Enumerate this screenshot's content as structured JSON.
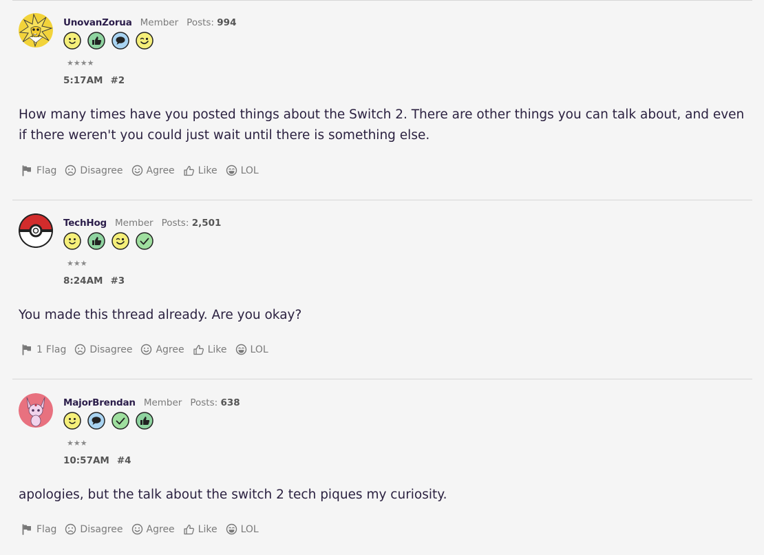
{
  "posts": [
    {
      "username": "UnovanZorua",
      "role": "Member",
      "posts_label": "Posts:",
      "posts_count": "994",
      "stars": "★★★★",
      "time": "5:17AM",
      "number": "#2",
      "body": "How many times have you posted things about the Switch 2. There are other things you can talk about, and even if there weren't you could just wait until there is something else.",
      "badges": [
        "smiley-badge-icon",
        "thumbs-up-badge-icon",
        "speech-bubble-badge-icon",
        "wink-badge-icon"
      ],
      "actions": {
        "flag": "Flag",
        "disagree": "Disagree",
        "agree": "Agree",
        "like": "Like",
        "lol": "LOL"
      }
    },
    {
      "username": "TechHog",
      "role": "Member",
      "posts_label": "Posts:",
      "posts_count": "2,501",
      "stars": "★★★",
      "time": "8:24AM",
      "number": "#3",
      "body": "You made this thread already. Are you okay?",
      "badges": [
        "smiley-badge-icon",
        "thumbs-up-badge-icon",
        "wink-badge-icon",
        "checkmark-badge-icon"
      ],
      "actions": {
        "flag_count": "1",
        "flag": "Flag",
        "disagree": "Disagree",
        "agree": "Agree",
        "like": "Like",
        "lol": "LOL"
      }
    },
    {
      "username": "MajorBrendan",
      "role": "Member",
      "posts_label": "Posts:",
      "posts_count": "638",
      "stars": "★★★",
      "time": "10:57AM",
      "number": "#4",
      "body": "apologies, but the talk about the switch 2 tech piques my curiosity.",
      "badges": [
        "smiley-badge-icon",
        "speech-bubble-badge-icon",
        "checkmark-badge-icon",
        "thumbs-up-badge-icon"
      ],
      "actions": {
        "flag": "Flag",
        "disagree": "Disagree",
        "agree": "Agree",
        "like": "Like",
        "lol": "LOL"
      }
    }
  ],
  "colors": {
    "badge_yellow": "#f5ef7a",
    "badge_green": "#9fdf9f",
    "badge_blue": "#a9d4f2",
    "text": "#2b2140",
    "muted": "#7a7a7a",
    "background": "#f5f5f5"
  }
}
